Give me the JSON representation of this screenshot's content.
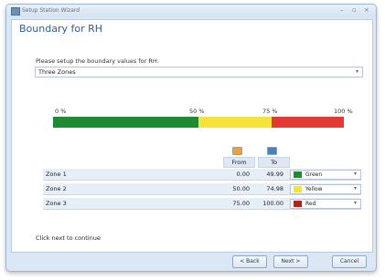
{
  "window": {
    "title": "Setup Station Wizard",
    "controls": [
      "–",
      "▫",
      "×"
    ]
  },
  "page": {
    "heading": "Boundary for RH",
    "prompt": "Please setup the boundary values for RH:",
    "mode_value": "Three Zones"
  },
  "scale": {
    "ticks": [
      "0 %",
      "50 %",
      "75 %",
      "100 %"
    ],
    "segments": [
      {
        "from": 0,
        "to": 50,
        "color": "#1e8a34"
      },
      {
        "from": 50,
        "to": 75,
        "color": "#f3e33a"
      },
      {
        "from": 75,
        "to": 100,
        "color": "#e23a32"
      }
    ]
  },
  "table": {
    "headers": {
      "from": "From",
      "to": "To"
    },
    "rows": [
      {
        "zone": "Zone 1",
        "from": "0.00",
        "to": "49.99",
        "color": "Green",
        "hex": "#1e8a34"
      },
      {
        "zone": "Zone 2",
        "from": "50.00",
        "to": "74.98",
        "color": "Yellow",
        "hex": "#f3e33a"
      },
      {
        "zone": "Zone 3",
        "from": "75.00",
        "to": "100.00",
        "color": "Red",
        "hex": "#b8201c"
      }
    ]
  },
  "footer": {
    "text": "Click next to continue",
    "back": "< Back",
    "next": "Next >",
    "cancel": "Cancel"
  },
  "colors": {
    "accent": "#2d5f9a",
    "from_icon": "#f0a030",
    "to_icon": "#4a7fc0"
  }
}
